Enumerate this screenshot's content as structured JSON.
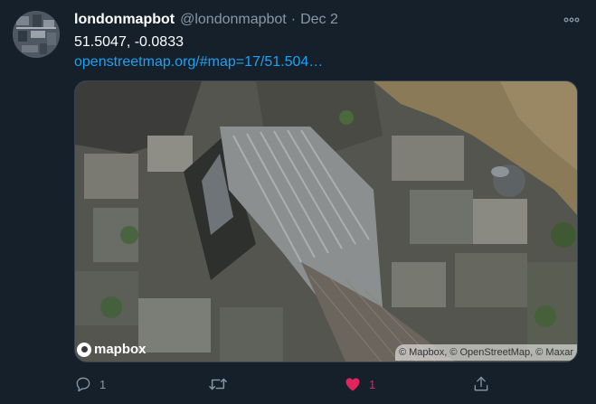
{
  "tweet": {
    "display_name": "londonmapbot",
    "handle": "@londonmapbot",
    "separator": "·",
    "date": "Dec 2",
    "coordinates": "51.5047, -0.0833",
    "link": "openstreetmap.org/#map=17/51.504…"
  },
  "map": {
    "logo_text": "mapbox",
    "attribution": "© Mapbox, © OpenStreetMap, © Maxar"
  },
  "actions": {
    "reply_count": "1",
    "like_count": "1"
  },
  "colors": {
    "background": "#15202b",
    "text": "#ffffff",
    "secondary": "#8899a6",
    "link": "#1da1f2",
    "like": "#e0245e"
  },
  "icons": {
    "more": "more-horizontal-icon",
    "reply": "reply-icon",
    "retweet": "retweet-icon",
    "like": "heart-icon",
    "share": "share-icon"
  }
}
